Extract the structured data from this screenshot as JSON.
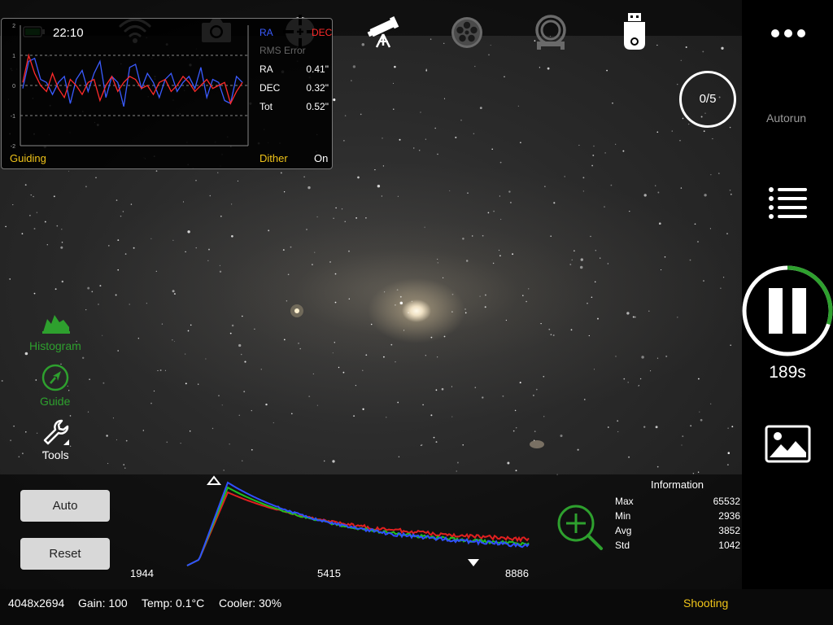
{
  "top_bar": {
    "time": "22:10",
    "icons": [
      "battery-icon",
      "wifi-icon",
      "camera-icon",
      "guide-target-icon",
      "telescope-icon",
      "filter-wheel-icon",
      "focuser-icon",
      "usb-drive-icon",
      "more-icon"
    ]
  },
  "guiding": {
    "chart_data": {
      "type": "line",
      "title": "",
      "ylabel": "",
      "xlabel": "",
      "ylim": [
        -2,
        2
      ],
      "y_ticks": [
        "2",
        "1",
        "0",
        "-1",
        "-2"
      ],
      "series": [
        {
          "name": "RA",
          "color": "#3a5bff",
          "values": [
            -0.1,
            0.8,
            0.9,
            0.2,
            0.1,
            -0.3,
            0.1,
            0.3,
            -0.6,
            0.2,
            0.5,
            -0.2,
            0.4,
            0.8,
            -0.4,
            0.3,
            0.1,
            -0.7,
            0.6,
            0.7,
            -0.1,
            0.4,
            0.1,
            -0.4,
            0.2,
            0.4,
            -0.2,
            0.1,
            0.3,
            -0.1,
            0.6,
            -0.4,
            0.2,
            0.1,
            -0.5,
            -0.6,
            0.3,
            0.1
          ]
        },
        {
          "name": "DEC",
          "color": "#ff2a2a",
          "values": [
            0.1,
            1.0,
            0.4,
            0.0,
            -0.2,
            0.4,
            -0.1,
            -0.4,
            0.2,
            0.0,
            -0.3,
            0.1,
            0.2,
            -0.5,
            0.0,
            0.3,
            -0.2,
            0.1,
            0.3,
            0.2,
            -0.1,
            0.0,
            -0.3,
            0.1,
            0.2,
            -0.2,
            0.0,
            0.3,
            0.1,
            -0.2,
            0.0,
            0.2,
            -0.1,
            0.0,
            0.1,
            -0.6,
            -0.2,
            0.1
          ]
        }
      ]
    },
    "legend_ra": "RA",
    "legend_dec": "DEC",
    "rms_label": "RMS Error",
    "rows": [
      {
        "label": "RA",
        "value": "0.41\""
      },
      {
        "label": "DEC",
        "value": "0.32\""
      },
      {
        "label": "Tot",
        "value": "0.52\""
      }
    ],
    "footer_label": "Guiding",
    "dither_label": "Dither",
    "dither_value": "On"
  },
  "left_tools": {
    "histogram": "Histogram",
    "guide": "Guide",
    "tools": "Tools"
  },
  "right_bar": {
    "counter": "0/5",
    "autorun": "Autorun",
    "countdown": "189s",
    "progress": 0.3
  },
  "histogram_panel": {
    "auto_button": "Auto",
    "reset_button": "Reset",
    "x_ticks": [
      "1944",
      "5415",
      "8886"
    ],
    "info_title": "Information",
    "info": [
      {
        "label": "Max",
        "value": "65532"
      },
      {
        "label": "Min",
        "value": "2936"
      },
      {
        "label": "Avg",
        "value": "3852"
      },
      {
        "label": "Std",
        "value": "1042"
      }
    ]
  },
  "status_bar": {
    "resolution": "4048x2694",
    "gain": "Gain: 100",
    "temp": "Temp: 0.1°C",
    "cooler": "Cooler: 30%",
    "mode": "Shooting"
  },
  "colors": {
    "accent_green": "#2ea02e",
    "accent_yellow": "#f0c419",
    "ra_blue": "#3a5bff",
    "dec_red": "#ff2a2a"
  }
}
